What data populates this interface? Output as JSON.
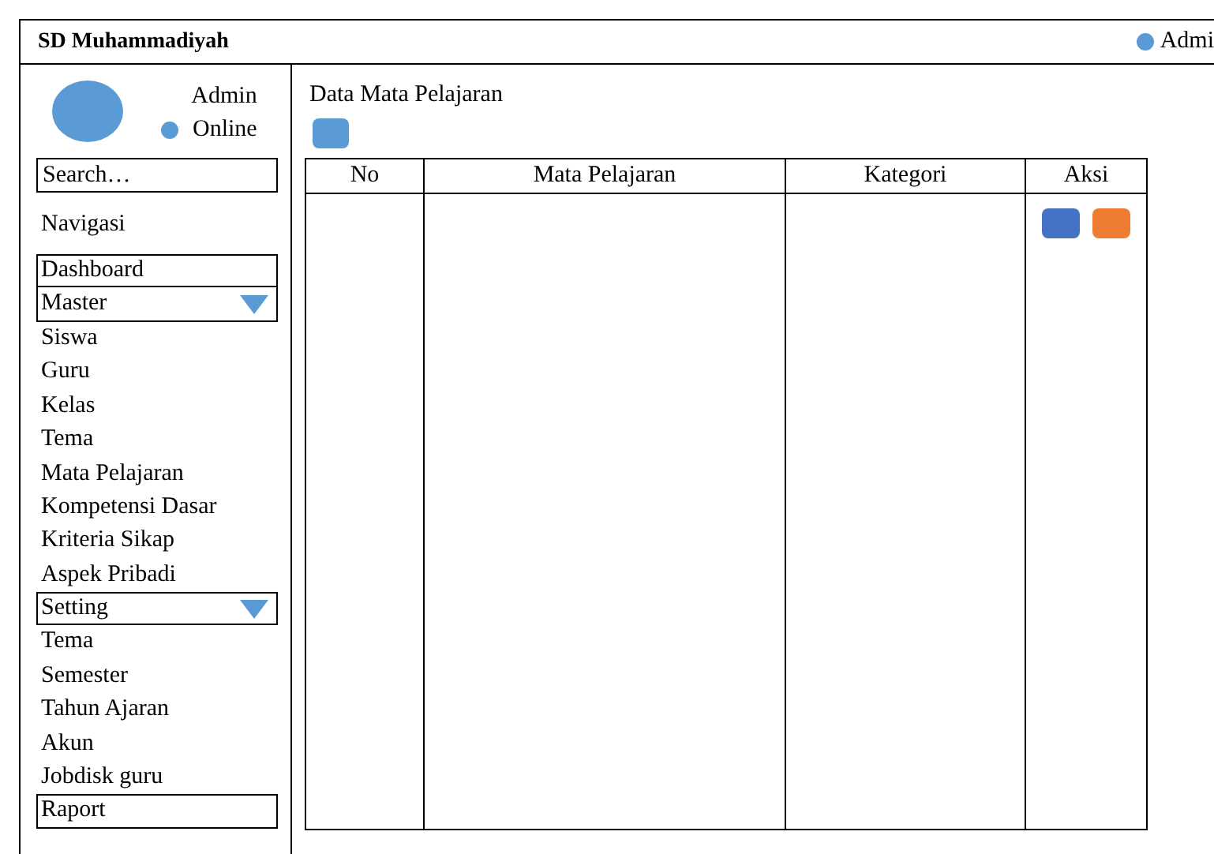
{
  "header": {
    "title": "SD Muhammadiyah",
    "user": {
      "name": "Admi",
      "online": true
    }
  },
  "sidebar": {
    "profile": {
      "name": "Admin",
      "status": "Online",
      "online": true
    },
    "search": {
      "placeholder": "Search…"
    },
    "heading": "Navigasi",
    "items": [
      {
        "label": "Dashboard",
        "kind": "box"
      },
      {
        "label": "Master",
        "kind": "group",
        "expanded": true
      },
      {
        "label": "Siswa",
        "kind": "link"
      },
      {
        "label": "Guru",
        "kind": "link"
      },
      {
        "label": "Kelas",
        "kind": "link"
      },
      {
        "label": "Tema",
        "kind": "link"
      },
      {
        "label": "Mata Pelajaran",
        "kind": "link"
      },
      {
        "label": "Kompetensi Dasar",
        "kind": "link"
      },
      {
        "label": "Kriteria Sikap",
        "kind": "link"
      },
      {
        "label": "Aspek Pribadi",
        "kind": "link"
      },
      {
        "label": "Setting",
        "kind": "group",
        "expanded": true
      },
      {
        "label": "Tema",
        "kind": "link"
      },
      {
        "label": "Semester",
        "kind": "link"
      },
      {
        "label": "Tahun Ajaran",
        "kind": "link"
      },
      {
        "label": "Akun",
        "kind": "link"
      },
      {
        "label": "Jobdisk guru",
        "kind": "link"
      },
      {
        "label": "Raport",
        "kind": "box"
      }
    ]
  },
  "content": {
    "title": "Data Mata Pelajaran",
    "table": {
      "columns": [
        "No",
        "Mata Pelajaran",
        "Kategori",
        "Aksi"
      ],
      "rows": [
        {
          "actions": [
            {
              "color": "#4472c4"
            },
            {
              "color": "#ed7d31"
            }
          ]
        }
      ]
    }
  }
}
